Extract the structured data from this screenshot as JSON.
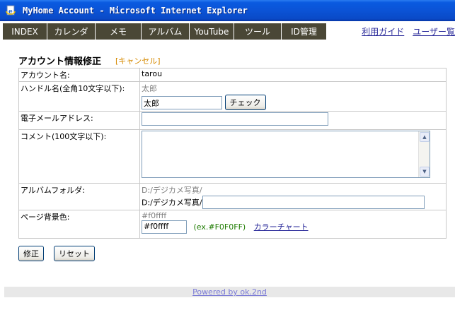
{
  "window": {
    "title": "MyHome Account - Microsoft Internet Explorer",
    "icon": "ie-page-icon"
  },
  "nav": {
    "tabs": [
      "INDEX",
      "カレンダ",
      "メモ",
      "アルバム",
      "YouTube",
      "ツール",
      "ID管理"
    ],
    "links": [
      "利用ガイド",
      "ユーザー覧"
    ]
  },
  "heading": {
    "title": "アカウント情報修正",
    "cancel": "[キャンセル]"
  },
  "form": {
    "account_label": "アカウント名:",
    "account_value": "tarou",
    "handle_label": "ハンドル名(全角10文字以下):",
    "handle_current": "太郎",
    "handle_input": "太郎",
    "check_button": "チェック",
    "email_label": "電子メールアドレス:",
    "email_value": "",
    "comment_label": "コメント(100文字以下):",
    "comment_value": "",
    "album_label": "アルバムフォルダ:",
    "album_current": "D:/デジカメ写真/",
    "album_prefix": "D:/デジカメ写真/",
    "album_input": "",
    "bg_label": "ページ背景色:",
    "bg_current": "#f0ffff",
    "bg_input": "#f0ffff",
    "bg_example": "(ex.#F0F0FF)",
    "color_chart": "カラーチャート"
  },
  "buttons": {
    "submit": "修正",
    "reset": "リセット"
  },
  "footer": {
    "powered": "Powered by ok.2nd"
  },
  "colors": {
    "titlebar": "#0a53d6",
    "nav_bg": "#4a4736",
    "link": "#2a2a9a",
    "cancel": "#d68a00",
    "example": "#1e7b00"
  }
}
